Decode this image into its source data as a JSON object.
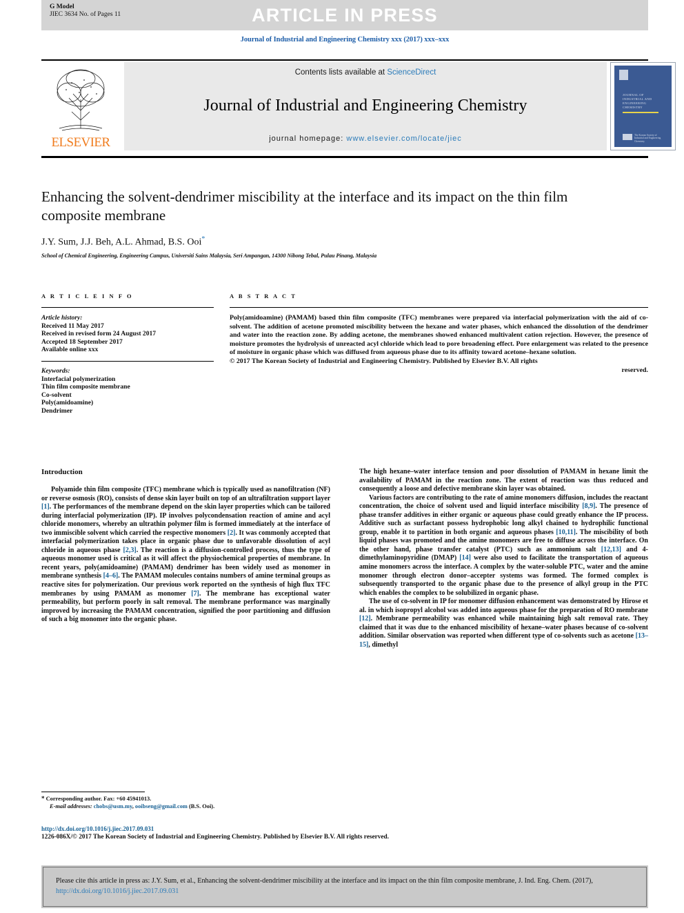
{
  "banner": {
    "g_model": "G Model",
    "g_model_line2": "JIEC 3634 No. of Pages 11",
    "article_in_press": "ARTICLE IN PRESS",
    "banner_color": "#d4d4d4"
  },
  "running_head": "Journal of Industrial and Engineering Chemistry xxx (2017) xxx–xxx",
  "masthead": {
    "contents_prefix": "Contents lists available at ",
    "sciencedirect": "ScienceDirect",
    "journal_title": "Journal of Industrial and Engineering Chemistry",
    "homepage_prefix": "journal homepage: ",
    "homepage_url": "www.elsevier.com/locate/jiec",
    "publisher": "ELSEVIER",
    "cover_title": "JOURNAL OF INDUSTRIAL AND ENGINEERING CHEMISTRY",
    "cover_society": "The Korean Society of Industrial and Engineering Chemistry",
    "link_color": "#2b7bb9"
  },
  "article": {
    "title": "Enhancing the solvent-dendrimer miscibility at the interface and its impact on the thin film composite membrane",
    "authors": "J.Y. Sum, J.J. Beh, A.L. Ahmad, B.S. Ooi",
    "corresponding_marker": "*",
    "affiliation": "School of Chemical Engineering, Engineering Campus, Universiti Sains Malaysia, Seri Ampangan, 14300 Nibong Tebal, Pulau Pinang, Malaysia"
  },
  "article_info": {
    "heading": "A R T I C L E  I N F O",
    "history_label": "Article history:",
    "received": "Received 11 May 2017",
    "revised": "Received in revised form 24 August 2017",
    "accepted": "Accepted 18 September 2017",
    "available": "Available online xxx",
    "keywords_label": "Keywords:",
    "keywords": [
      "Interfacial polymerization",
      "Thin film composite membrane",
      "Co-solvent",
      "Poly(amidoamine)",
      "Dendrimer"
    ]
  },
  "abstract": {
    "heading": "A B S T R A C T",
    "body": "Poly(amidoamine) (PAMAM) based thin film composite (TFC) membranes were prepared via interfacial polymerization with the aid of co-solvent. The addition of acetone promoted miscibility between the hexane and water phases, which enhanced the dissolution of the dendrimer and water into the reaction zone. By adding acetone, the membranes showed enhanced multivalent cation rejection. However, the presence of moisture promotes the hydrolysis of unreacted acyl chloride which lead to pore broadening effect. Pore enlargement was related to the presence of moisture in organic phase which was diffused from aqueous phase due to its affinity toward acetone–hexane solution.",
    "copyright": "© 2017 The Korean Society of Industrial and Engineering Chemistry. Published by Elsevier B.V. All rights",
    "copyright_tail": "reserved."
  },
  "body": {
    "intro_heading": "Introduction",
    "left_p1_a": "Polyamide thin film composite (TFC) membrane which is typically used as nanofiltration (NF) or reverse osmosis (RO), consists of dense skin layer built on top of an ultrafiltration support layer ",
    "left_p1_r1": "[1]",
    "left_p1_b": ". The performances of the membrane depend on the skin layer properties which can be tailored during interfacial polymerization (IP). IP involves polycondensation reaction of amine and acyl chloride monomers, whereby an ultrathin polymer film is formed immediately at the interface of two immiscible solvent which carried the respective monomers ",
    "left_p1_r2": "[2]",
    "left_p1_c": ". It was commonly accepted that interfacial polymerization takes place in organic phase due to unfavorable dissolution of acyl chloride in aqueous phase ",
    "left_p1_r3": "[2,3]",
    "left_p1_d": ". The reaction is a diffusion-controlled process, thus the type of aqueous monomer used is critical as it will affect the physiochemical properties of membrane. In recent years, poly(amidoamine) (PAMAM) dendrimer has been widely used as monomer in membrane synthesis ",
    "left_p1_r4": "[4–6]",
    "left_p1_e": ". The PAMAM molecules contains numbers of amine terminal groups as reactive sites for polymerization. Our previous work reported on the synthesis of high flux TFC membranes by using PAMAM as monomer ",
    "left_p1_r5": "[7]",
    "left_p1_f": ". The membrane has exceptional water permeability, but perform poorly in salt removal. The membrane performance was marginally improved by increasing the PAMAM concentration, signified the poor partitioning and diffusion of such a big monomer into the organic phase.",
    "right_p1": "The high hexane–water interface tension and poor dissolution of PAMAM in hexane limit the availability of PAMAM in the reaction zone. The extent of reaction was thus reduced and consequently a loose and defective membrane skin layer was obtained.",
    "right_p2_a": "Various factors are contributing to the rate of amine monomers diffusion, includes the reactant concentration, the choice of solvent used and liquid interface miscibility ",
    "right_p2_r1": "[8,9]",
    "right_p2_b": ". The presence of phase transfer additives in either organic or aqueous phase could greatly enhance the IP process. Additive such as surfactant possess hydrophobic long alkyl chained to hydrophilic functional group, enable it to partition in both organic and aqueous phases ",
    "right_p2_r2": "[10,11]",
    "right_p2_c": ". The miscibility of both liquid phases was promoted and the amine monomers are free to diffuse across the interface. On the other hand, phase transfer catalyst (PTC) such as ammonium salt ",
    "right_p2_r3": "[12,13]",
    "right_p2_d": " and 4-dimethylaminopyridine (DMAP) ",
    "right_p2_r4": "[14]",
    "right_p2_e": " were also used to facilitate the transportation of aqueous amine monomers across the interface. A complex by the water-soluble PTC, water and the amine monomer through electron donor–accepter systems was formed. The formed complex is subsequently transported to the organic phase due to the presence of alkyl group in the PTC which enables the complex to be solubilized in organic phase.",
    "right_p3_a": "The use of co-solvent in IP for monomer diffusion enhancement was demonstrated by Hirose et al. in which isopropyl alcohol was added into aqueous phase for the preparation of RO membrane ",
    "right_p3_r1": "[12]",
    "right_p3_b": ". Membrane permeability was enhanced while maintaining high salt removal rate. They claimed that it was due to the enhanced miscibility of hexane–water phases because of co-solvent addition. Similar observation was reported when different type of co-solvents such as acetone ",
    "right_p3_r2": "[13–15]",
    "right_p3_c": ", dimethyl"
  },
  "footnote": {
    "star": "*",
    "corresponding": "Corresponding author. Fax: +60 45941013.",
    "email_label": "E-mail addresses:",
    "email1": "chobs@usm.my",
    "email2": "ooibseng@gmail.com",
    "email_owner": "(B.S. Ooi).",
    "doi_url": "http://dx.doi.org/10.1016/j.jiec.2017.09.031",
    "issn_line": "1226-086X/© 2017 The Korean Society of Industrial and Engineering Chemistry. Published by Elsevier B.V. All rights reserved."
  },
  "cite_box": {
    "text_a": "Please cite this article in press as: J.Y. Sum, et al., Enhancing the solvent-dendrimer miscibility at the interface and its impact on the thin film composite membrane, J. Ind. Eng. Chem. (2017), ",
    "link": "http://dx.doi.org/10.1016/j.jiec.2017.09.031",
    "bg_color": "#c9c9c9"
  }
}
